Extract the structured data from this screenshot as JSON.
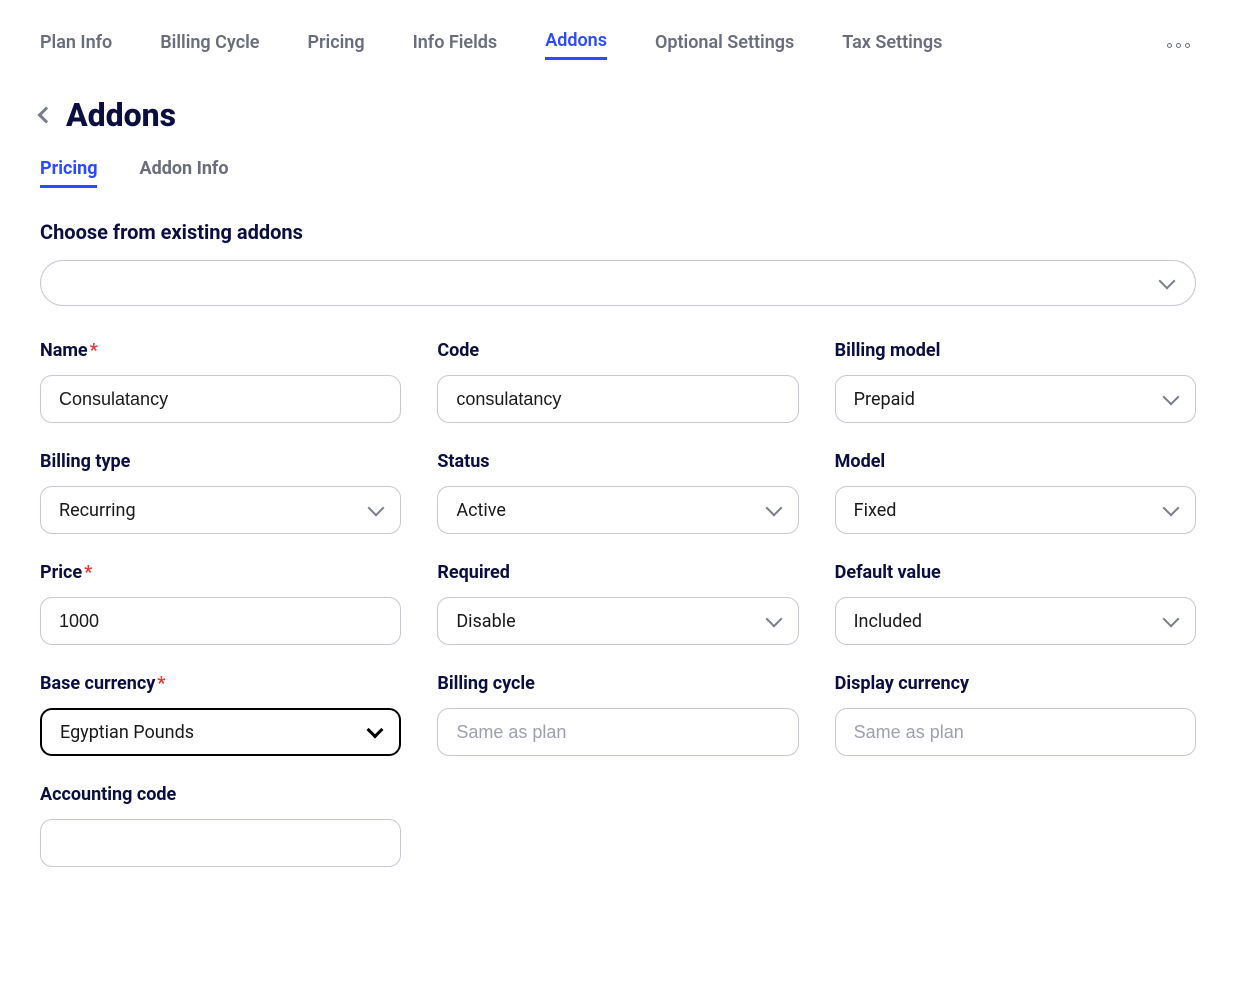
{
  "topnav": {
    "items": [
      {
        "label": "Plan Info",
        "active": false
      },
      {
        "label": "Billing Cycle",
        "active": false
      },
      {
        "label": "Pricing",
        "active": false
      },
      {
        "label": "Info Fields",
        "active": false
      },
      {
        "label": "Addons",
        "active": true
      },
      {
        "label": "Optional Settings",
        "active": false
      },
      {
        "label": "Tax Settings",
        "active": false
      }
    ]
  },
  "page_title": "Addons",
  "subtabs": [
    {
      "label": "Pricing",
      "active": true
    },
    {
      "label": "Addon Info",
      "active": false
    }
  ],
  "existing_addons_label": "Choose from existing addons",
  "fields": {
    "name": {
      "label": "Name",
      "required": true,
      "value": "Consulatancy"
    },
    "code": {
      "label": "Code",
      "required": false,
      "value": "consulatancy"
    },
    "billing_model": {
      "label": "Billing model",
      "required": false,
      "value": "Prepaid"
    },
    "billing_type": {
      "label": "Billing type",
      "required": false,
      "value": "Recurring"
    },
    "status": {
      "label": "Status",
      "required": false,
      "value": "Active"
    },
    "model": {
      "label": "Model",
      "required": false,
      "value": "Fixed"
    },
    "price": {
      "label": "Price",
      "required": true,
      "value": "1000"
    },
    "required_field": {
      "label": "Required",
      "required": false,
      "value": "Disable"
    },
    "default_value": {
      "label": "Default value",
      "required": false,
      "value": "Included"
    },
    "base_currency": {
      "label": "Base currency",
      "required": true,
      "value": "Egyptian Pounds",
      "focused": true
    },
    "billing_cycle": {
      "label": "Billing cycle",
      "required": false,
      "placeholder": "Same as plan"
    },
    "display_currency": {
      "label": "Display currency",
      "required": false,
      "placeholder": "Same as plan"
    },
    "accounting_code": {
      "label": "Accounting code",
      "required": false,
      "value": ""
    }
  }
}
